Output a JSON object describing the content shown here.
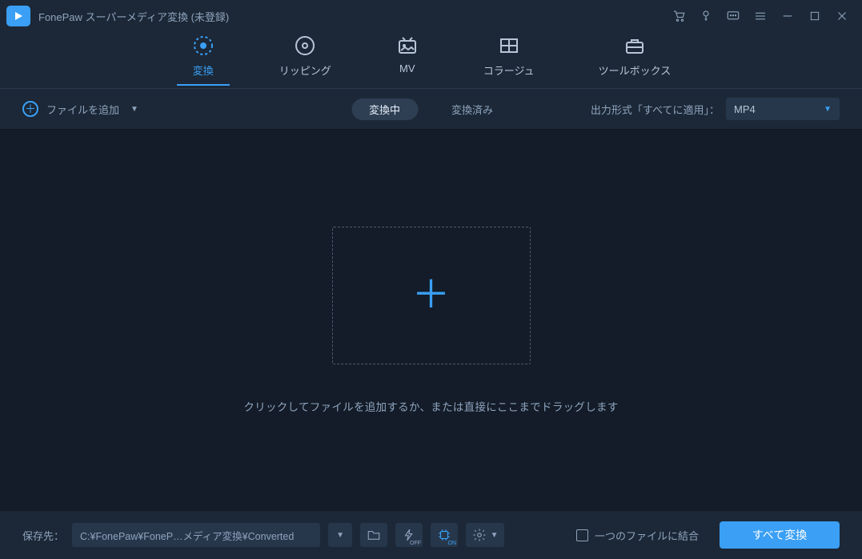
{
  "titlebar": {
    "title": "FonePaw スーパーメディア変換 (未登録)"
  },
  "nav": {
    "convert": "変換",
    "ripping": "リッピング",
    "mv": "MV",
    "collage": "コラージュ",
    "toolbox": "ツールボックス"
  },
  "toolbar": {
    "add_file": "ファイルを追加",
    "converting_tab": "変換中",
    "converted_tab": "変換済み",
    "format_label": "出力形式「すべてに適用」：",
    "format_value": "MP4"
  },
  "content": {
    "hint": "クリックしてファイルを追加するか、または直接にここまでドラッグします"
  },
  "footer": {
    "save_label": "保存先：",
    "save_path": "C:¥FonePaw¥FoneP…メディア変換¥Converted",
    "lightning_badge": "OFF",
    "gpu_badge": "ON",
    "merge_label": "一つのファイルに結合",
    "convert_button": "すべて変換"
  }
}
